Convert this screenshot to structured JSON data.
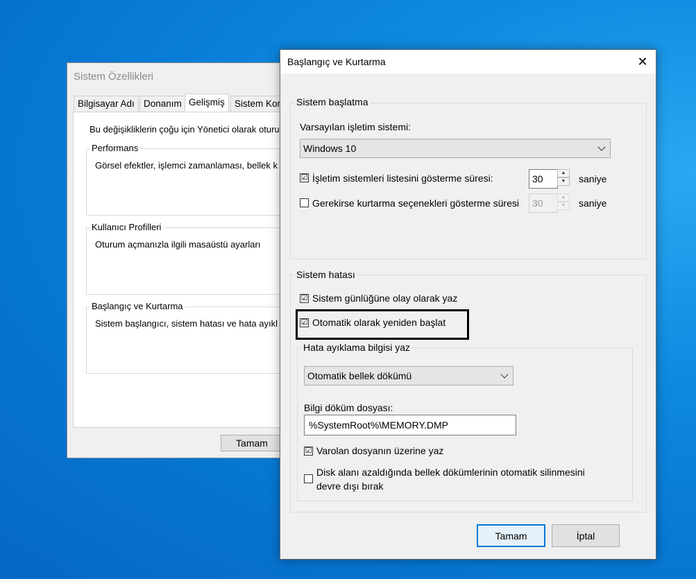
{
  "back_window": {
    "title": "Sistem Özellikleri",
    "tabs": [
      "Bilgisayar Adı",
      "Donanım",
      "Gelişmiş",
      "Sistem Koru"
    ],
    "intro": "Bu değişikliklerin çoğu için Yönetici olarak oturu",
    "groups": [
      {
        "label": "Performans",
        "text": "Görsel efektler, işlemci zamanlaması, bellek k"
      },
      {
        "label": "Kullanıcı Profilleri",
        "text": "Oturum açmanızla ilgili masaüstü ayarları"
      },
      {
        "label": "Başlangıç ve Kurtarma",
        "text": "Sistem başlangıcı, sistem hatası ve hata ayıkl"
      }
    ],
    "ok_label": "Tamam"
  },
  "dialog": {
    "title": "Başlangıç ve Kurtarma",
    "startup": {
      "group_label": "Sistem başlatma",
      "default_os_label": "Varsayılan işletim sistemi:",
      "default_os_value": "Windows 10",
      "show_list_label": "İşletim sistemleri listesini gösterme süresi:",
      "show_list_checked": true,
      "show_list_seconds": "30",
      "show_recovery_label": "Gerekirse kurtarma seçenekleri gösterme süresi",
      "show_recovery_checked": false,
      "show_recovery_seconds": "30",
      "seconds_unit": "saniye"
    },
    "failure": {
      "group_label": "Sistem hatası",
      "write_event_label": "Sistem günlüğüne olay olarak yaz",
      "write_event_checked": true,
      "auto_restart_label": "Otomatik olarak yeniden başlat",
      "auto_restart_checked": true,
      "debug": {
        "group_label": "Hata ayıklama bilgisi yaz",
        "dump_type": "Otomatik bellek dökümü",
        "dump_file_label": "Bilgi döküm dosyası:",
        "dump_file_value": "%SystemRoot%\\MEMORY.DMP",
        "overwrite_label": "Varolan dosyanın üzerine yaz",
        "overwrite_checked": true,
        "disable_autodelete_label": "Disk alanı azaldığında bellek dökümlerinin otomatik silinmesini",
        "disable_autodelete_label_2": "devre dışı bırak",
        "disable_autodelete_checked": false
      }
    },
    "ok_label": "Tamam",
    "cancel_label": "İptal"
  },
  "check_mark": "☑",
  "colors": {
    "desktop": "#0676d1",
    "highlight": "#000000",
    "default_button_border": "#0078d7"
  }
}
